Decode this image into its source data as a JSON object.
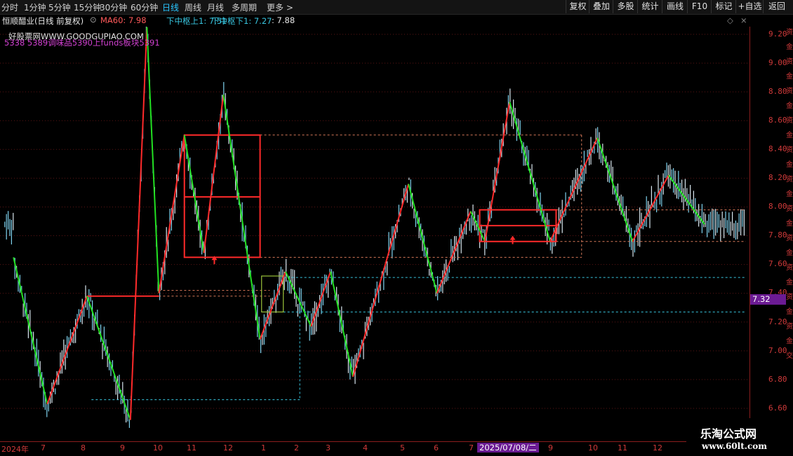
{
  "toolbar": {
    "timeframes": [
      "分时",
      "1分钟",
      "5分钟",
      "15分钟",
      "30分钟",
      "60分钟",
      "日线",
      "周线",
      "月线",
      "多周期",
      "更多 >"
    ],
    "active_timeframe": "日线",
    "right_buttons": [
      "复权",
      "叠加",
      "多股",
      "统计",
      "画线",
      "F10",
      "标记",
      "+自选",
      "返回"
    ]
  },
  "info": {
    "stock_title": "恒顺醋业(日线 前复权)",
    "ma60": "MA60: 7.98",
    "upper": "下中枢上1: 7.51",
    "lower": "下中枢下1: 7.27",
    "last": ": 7.88",
    "icons": [
      "diamond-icon",
      "close-icon"
    ]
  },
  "watermark": {
    "site": "好股票网WWW.GOODGUPIAO.COM",
    "sectors": "5338 5389调味品5390上funds板块5391"
  },
  "price_axis": {
    "labels": [
      "9.20",
      "9.00",
      "8.80",
      "8.60",
      "8.40",
      "8.20",
      "8.00",
      "7.80",
      "7.60",
      "7.40",
      "7.20",
      "7.00",
      "6.80",
      "6.60"
    ],
    "current": "7.32"
  },
  "date_axis": {
    "labels": [
      "2024年",
      "7",
      "8",
      "9",
      "10",
      "11",
      "12",
      "1",
      "2",
      "3",
      "4",
      "5",
      "6",
      "7",
      "9",
      "10",
      "11",
      "12"
    ],
    "highlight": "2025/07/08/二"
  },
  "side_strip_chars": [
    "资",
    "金",
    "资",
    "金",
    "资",
    "金",
    "资",
    "金",
    "资",
    "金",
    "资",
    "金",
    "资",
    "金",
    "资",
    "金",
    "资",
    "金",
    "资",
    "金",
    "资",
    "金",
    "交"
  ],
  "brand": {
    "name": "乐淘公式网",
    "url": "www.60lt.com"
  },
  "colors": {
    "up_line": "#ff2a2a",
    "down_line": "#22e022",
    "candle": "#d8e6ef",
    "ma60_label": "#ff5a5a",
    "cyan": "#38c6e0",
    "axis": "#d03a3a",
    "highlight": "#6b1b93"
  },
  "chart_data": {
    "type": "line",
    "ylim": [
      6.52,
      9.3
    ],
    "zigzag_points": [
      {
        "t": 0.018,
        "price": 7.65
      },
      {
        "t": 0.063,
        "price": 6.63
      },
      {
        "t": 0.116,
        "price": 7.38
      },
      {
        "t": 0.174,
        "price": 6.52
      },
      {
        "t": 0.196,
        "price": 9.25
      },
      {
        "t": 0.212,
        "price": 7.4
      },
      {
        "t": 0.246,
        "price": 8.5
      },
      {
        "t": 0.272,
        "price": 7.68
      },
      {
        "t": 0.298,
        "price": 8.78
      },
      {
        "t": 0.347,
        "price": 7.08
      },
      {
        "t": 0.381,
        "price": 7.55
      },
      {
        "t": 0.415,
        "price": 7.17
      },
      {
        "t": 0.441,
        "price": 7.55
      },
      {
        "t": 0.471,
        "price": 6.82
      },
      {
        "t": 0.545,
        "price": 8.16
      },
      {
        "t": 0.583,
        "price": 7.4
      },
      {
        "t": 0.628,
        "price": 7.97
      },
      {
        "t": 0.647,
        "price": 7.76
      },
      {
        "t": 0.68,
        "price": 8.73
      },
      {
        "t": 0.734,
        "price": 7.76
      },
      {
        "t": 0.797,
        "price": 8.48
      },
      {
        "t": 0.844,
        "price": 7.76
      },
      {
        "t": 0.892,
        "price": 8.22
      },
      {
        "t": 0.94,
        "price": 7.88
      }
    ],
    "pivot_boxes_price": [
      {
        "t1": 0.246,
        "t2": 0.347,
        "hi": 8.5,
        "lo": 7.65,
        "mid": 8.07
      },
      {
        "t1": 0.349,
        "t2": 0.378,
        "hi": 7.52,
        "lo": 7.27
      },
      {
        "t1": 0.64,
        "t2": 0.742,
        "hi": 7.98,
        "lo": 7.76,
        "mid": 7.87
      }
    ],
    "levels": {
      "ma60": 7.98,
      "upper": 7.51,
      "lower": 7.27,
      "current": 7.32
    }
  }
}
